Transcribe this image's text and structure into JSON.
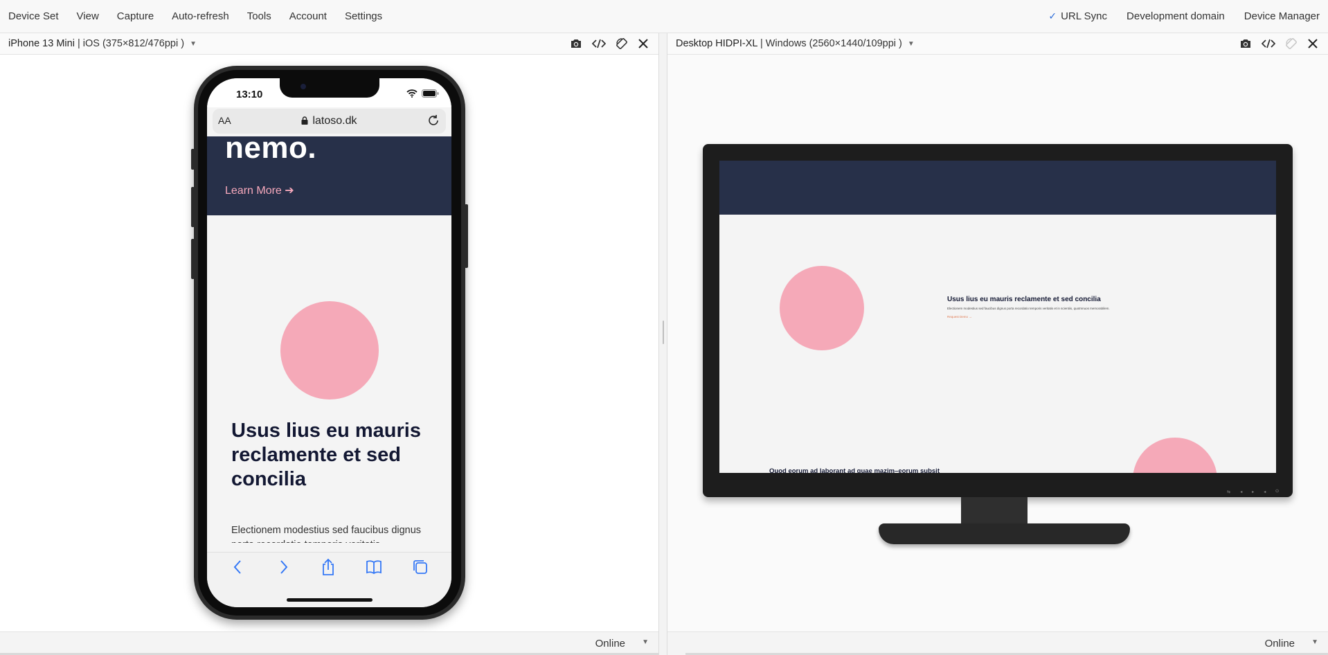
{
  "menubar": {
    "left_items": [
      "Device Set",
      "View",
      "Capture",
      "Auto-refresh",
      "Tools",
      "Account",
      "Settings"
    ],
    "url_sync": "URL Sync",
    "development_domain": "Development domain",
    "device_manager": "Device Manager"
  },
  "left_panel": {
    "device_name": "iPhone 13 Mini",
    "device_spec": "| iOS (375×812/476ppi )",
    "footer_status": "Online",
    "phone": {
      "time": "13:10",
      "text_size": "AA",
      "domain": "latoso.dk",
      "hero_text": "nemo.",
      "learn_more": "Learn More ➔",
      "heading": "Usus lius eu mauris reclamente et sed concilia",
      "body": "Electionem modestius sed faucibus dignus porta recordatio temporis veritatis"
    }
  },
  "right_panel": {
    "device_name": "Desktop HIDPI-XL",
    "device_spec": "| Windows (2560×1440/109ppi )",
    "footer_status": "Online",
    "monitor": {
      "heading": "Usus lius eu mauris reclamente et sed concilia",
      "body": "Electionem modestius sed faucibus dignus porta recordatio temporis veritatis et in scientiis, quotmnuos memorabilem.",
      "link": "Request Demo →",
      "quote": "Quod eorum ad laborant ad quae mazim–eorum subsit"
    }
  },
  "colors": {
    "hero_navy": "#273049",
    "accent_pink": "#f5a9b8",
    "link_pink": "#f7a9bc",
    "check_blue": "#2a6ad8",
    "ios_blue": "#3478f6"
  }
}
